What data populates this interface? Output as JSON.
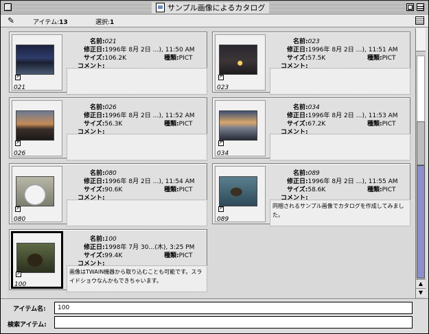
{
  "window": {
    "title": "サンプル画像によるカタログ"
  },
  "infobar": {
    "items_label": "アイテム:",
    "items_value": "13",
    "selected_label": "選択:",
    "selected_value": "1"
  },
  "labels": {
    "name": "名前:",
    "modified": "修正日:",
    "size": "サイズ:",
    "kind": "種類:",
    "comment": "コメント:"
  },
  "items": [
    {
      "name": "021",
      "modified": "1996年 8月 2日 …), 11:50 AM",
      "size": "106.2K",
      "kind": "PICT",
      "comment": ""
    },
    {
      "name": "023",
      "modified": "1996年 8月 2日 …), 11:51 AM",
      "size": "57.5K",
      "kind": "PICT",
      "comment": ""
    },
    {
      "name": "026",
      "modified": "1996年 8月 2日 …), 11:52 AM",
      "size": "56.3K",
      "kind": "PICT",
      "comment": ""
    },
    {
      "name": "034",
      "modified": "1996年 8月 2日 …), 11:53 AM",
      "size": "67.2K",
      "kind": "PICT",
      "comment": ""
    },
    {
      "name": "080",
      "modified": "1996年 8月 2日 …), 11:54 AM",
      "size": "90.6K",
      "kind": "PICT",
      "comment": ""
    },
    {
      "name": "089",
      "modified": "1996年 8月 2日 …), 11:55 AM",
      "size": "58.6K",
      "kind": "PICT",
      "comment": "同梱されるサンプル画像でカタログを作成してみました。"
    },
    {
      "name": "100",
      "modified": "1998年 7月 30…(木), 3:25 PM",
      "size": "99.4K",
      "kind": "PICT",
      "comment": "画像はTWAIN機器から取り込むことも可能です。スライドショウなんかもできちゃいます。"
    }
  ],
  "fields": {
    "item_name_label": "アイテム名:",
    "item_name_value": "100",
    "search_label": "検索アイテム:",
    "search_value": ""
  },
  "colors": {
    "scroll_thumb": "#8e8ecc"
  }
}
